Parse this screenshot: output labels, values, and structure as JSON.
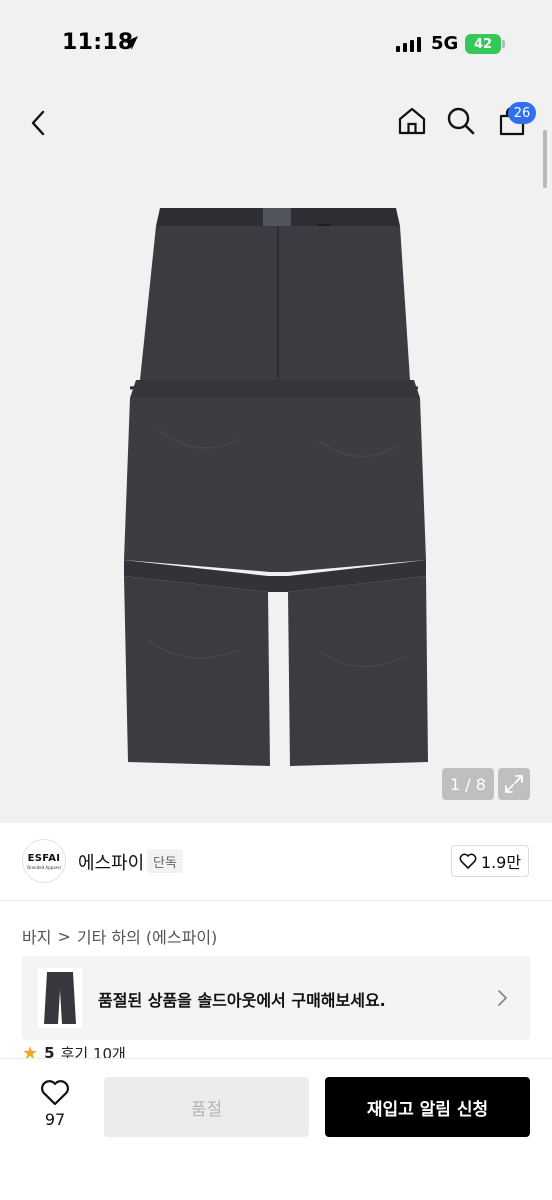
{
  "status_bar": {
    "time": "11:18",
    "network": "5G",
    "battery": "42"
  },
  "header": {
    "cart_badge": "26"
  },
  "gallery": {
    "counter": "1 / 8"
  },
  "brand": {
    "logo_text": "ESFAI",
    "logo_subtext": "Branded Apparel",
    "name": "에스파이",
    "tag": "단독",
    "likes": "1.9만"
  },
  "breadcrumb": {
    "items": [
      "바지",
      "기타 하의 (에스파이)"
    ],
    "separator": ">"
  },
  "soldout_banner": {
    "text": "품절된 상품을 솔드아웃에서 구매해보세요."
  },
  "rating": {
    "score": "5",
    "reviews": "후기 10개"
  },
  "bottom_bar": {
    "wish_count": "97",
    "soldout_label": "품절",
    "restock_label": "재입고 알림 신청"
  },
  "colors": {
    "accent_badge": "#2f6ff0",
    "battery": "#34c759",
    "primary_button": "#000000",
    "disabled_button": "#ececec"
  }
}
